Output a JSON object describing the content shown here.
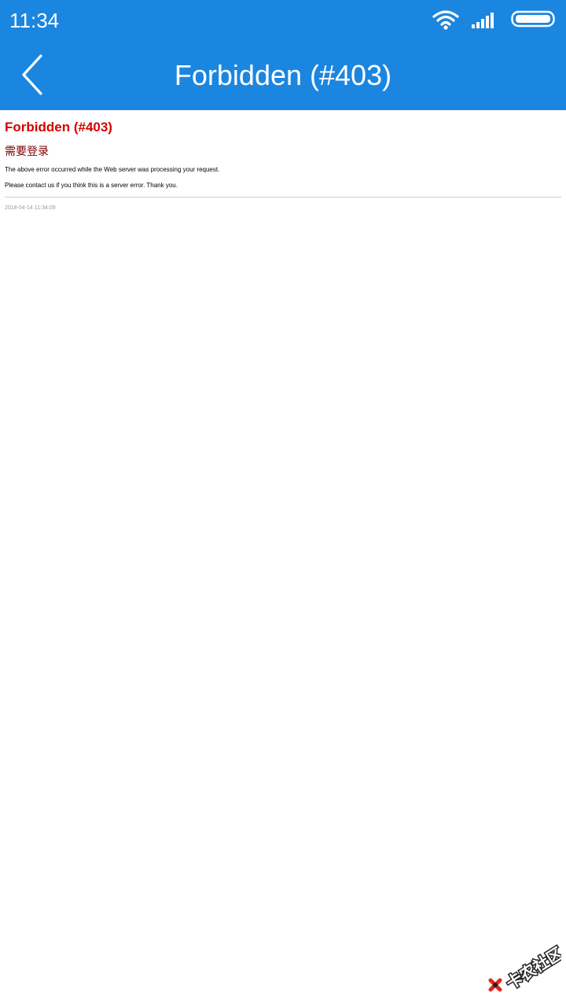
{
  "status_bar": {
    "time": "11:34",
    "icons": [
      "wifi-icon",
      "signal-icon",
      "battery-icon"
    ]
  },
  "header": {
    "back_icon": "chevron-left-icon",
    "title": "Forbidden (#403)",
    "background_color": "#1b86e0"
  },
  "error_page": {
    "title": "Forbidden (#403)",
    "message": "需要登录",
    "description_1": "The above error occurred while the Web server was processing your request.",
    "description_2": "Please contact us if you think this is a server error. Thank you.",
    "timestamp": "2018-04-14 11:34:09",
    "title_color": "#d90000",
    "message_color": "#800000"
  },
  "watermark": {
    "text": "卡农社区",
    "icon": "logo-icon"
  }
}
